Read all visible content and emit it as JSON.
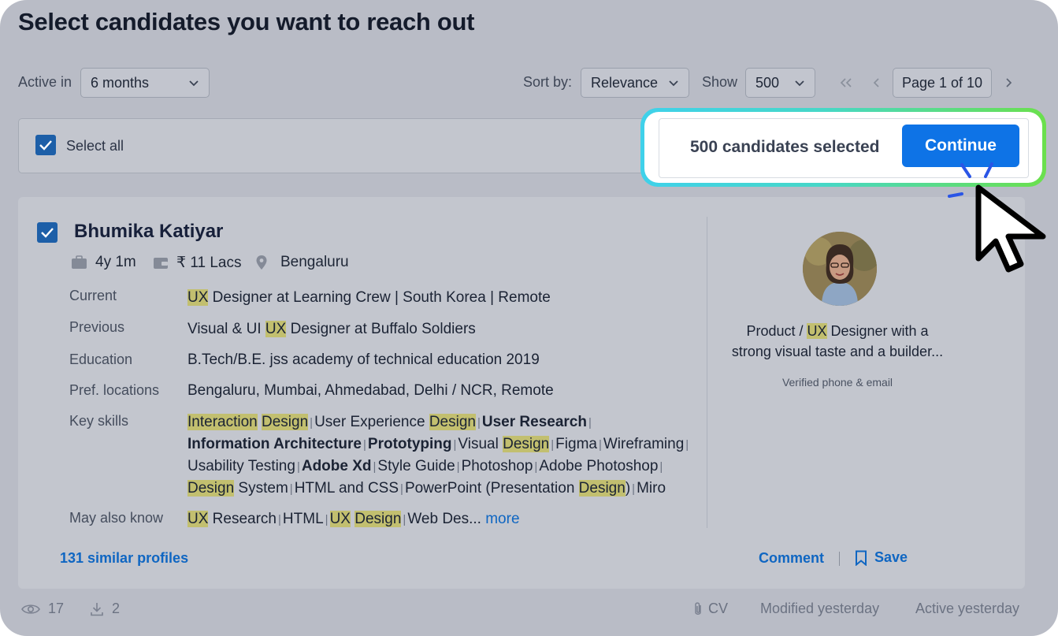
{
  "page": {
    "title": "Select candidates you want to reach out"
  },
  "filters": {
    "active_in_label": "Active in",
    "active_in_value": "6 months",
    "sort_label": "Sort by:",
    "sort_value": "Relevance",
    "show_label": "Show",
    "show_value": "500",
    "page_indicator": "Page 1 of 10"
  },
  "selection": {
    "select_all_label": "Select all",
    "select_all_checked": true,
    "count_text": "500 candidates selected",
    "continue_label": "Continue"
  },
  "candidate": {
    "name": "Bhumika Katiyar",
    "checked": true,
    "experience": "4y 1m",
    "salary": "₹ 11 Lacs",
    "location": "Bengaluru",
    "labels": {
      "current": "Current",
      "previous": "Previous",
      "education": "Education",
      "pref_locations": "Pref. locations",
      "key_skills": "Key skills",
      "may_also_know": "May also know"
    },
    "current": {
      "hl": "UX",
      "rest": " Designer at Learning Crew | South Korea | Remote"
    },
    "previous": {
      "pre": "Visual & UI ",
      "hl": "UX",
      "post": " Designer at Buffalo Soldiers"
    },
    "education": "B.Tech/B.E. jss academy of technical education 2019",
    "pref_locations": "Bengaluru, Mumbai, Ahmedabad, Delhi / NCR, Remote",
    "skills": {
      "s1a": "Interaction",
      "s1b": "Design",
      "s2a": "User Experience ",
      "s2b": "Design",
      "s3": "User Research",
      "s4": "Information Architecture",
      "s5": "Prototyping",
      "s6a": "Visual ",
      "s6b": "Design",
      "s7": "Figma",
      "s8": "Wireframing",
      "s9": "Usability Testing",
      "s10": "Adobe Xd",
      "s11": "Style Guide",
      "s12": "Photoshop",
      "s13": "Adobe Photoshop",
      "s14a": "Design",
      "s14b": " System",
      "s15": "HTML and CSS",
      "s16a": "PowerPoint (Presentation ",
      "s16b": "Design",
      "s16c": ")",
      "s17": "Miro"
    },
    "may_also_know": {
      "m1a": "UX",
      "m1b": " Research",
      "m2": "HTML",
      "m3a": "UX",
      "m3b": "Design",
      "m4": "Web Des...",
      "more": "more"
    },
    "headline_pre": "Product / ",
    "headline_hl": "UX",
    "headline_line1_post": " Designer with a",
    "headline_line2": "strong visual taste and a builder...",
    "verified": "Verified phone & email",
    "similar_profiles": "131 similar profiles",
    "comment_label": "Comment",
    "save_label": "Save"
  },
  "footer": {
    "views": "17",
    "downloads": "2",
    "cv_label": "CV",
    "modified": "Modified yesterday",
    "active": "Active yesterday"
  },
  "colors": {
    "accent": "#0e73e6",
    "highlight": "#c2bf6f",
    "callout_gradient_start": "#3fd1ea",
    "callout_gradient_end": "#6be04c"
  }
}
